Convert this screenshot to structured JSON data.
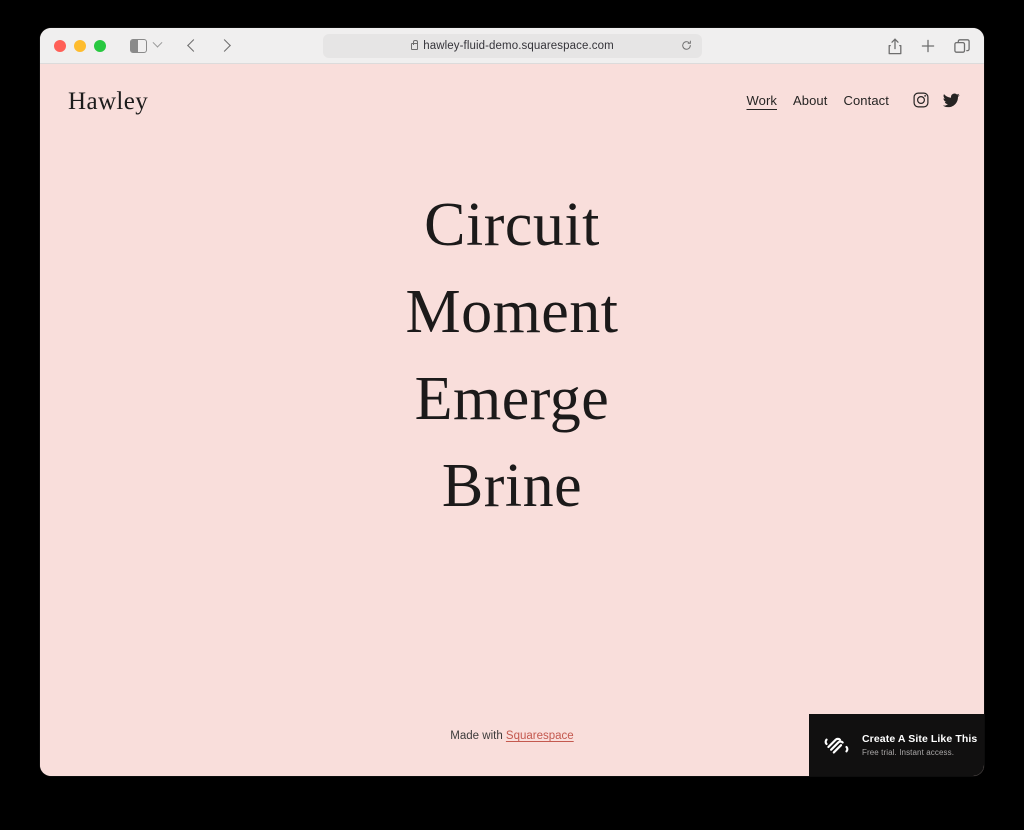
{
  "browser": {
    "traffic_lights": [
      "close",
      "minimize",
      "maximize"
    ],
    "sidebar_toggle_label": "sidebar-toggle",
    "back_label": "Back",
    "forward_label": "Forward",
    "url": "hawley-fluid-demo.squarespace.com",
    "reload_label": "Reload",
    "share_label": "Share",
    "new_tab_label": "New Tab",
    "tab_overview_label": "Tab Overview"
  },
  "site": {
    "logo": "Hawley",
    "nav": [
      {
        "label": "Work",
        "active": true
      },
      {
        "label": "About",
        "active": false
      },
      {
        "label": "Contact",
        "active": false
      }
    ],
    "social": [
      {
        "name": "instagram"
      },
      {
        "name": "twitter"
      }
    ],
    "hero_lines": [
      "Circuit",
      "Moment",
      "Emerge",
      "Brine"
    ],
    "footer": {
      "prefix": "Made with ",
      "link": "Squarespace"
    },
    "promo": {
      "title": "Create A Site Like This",
      "subtitle": "Free trial. Instant access."
    },
    "colors": {
      "background": "#f9dedb",
      "text": "#1c1a1a",
      "link": "#c4594f",
      "promo_bg": "#111010"
    }
  }
}
